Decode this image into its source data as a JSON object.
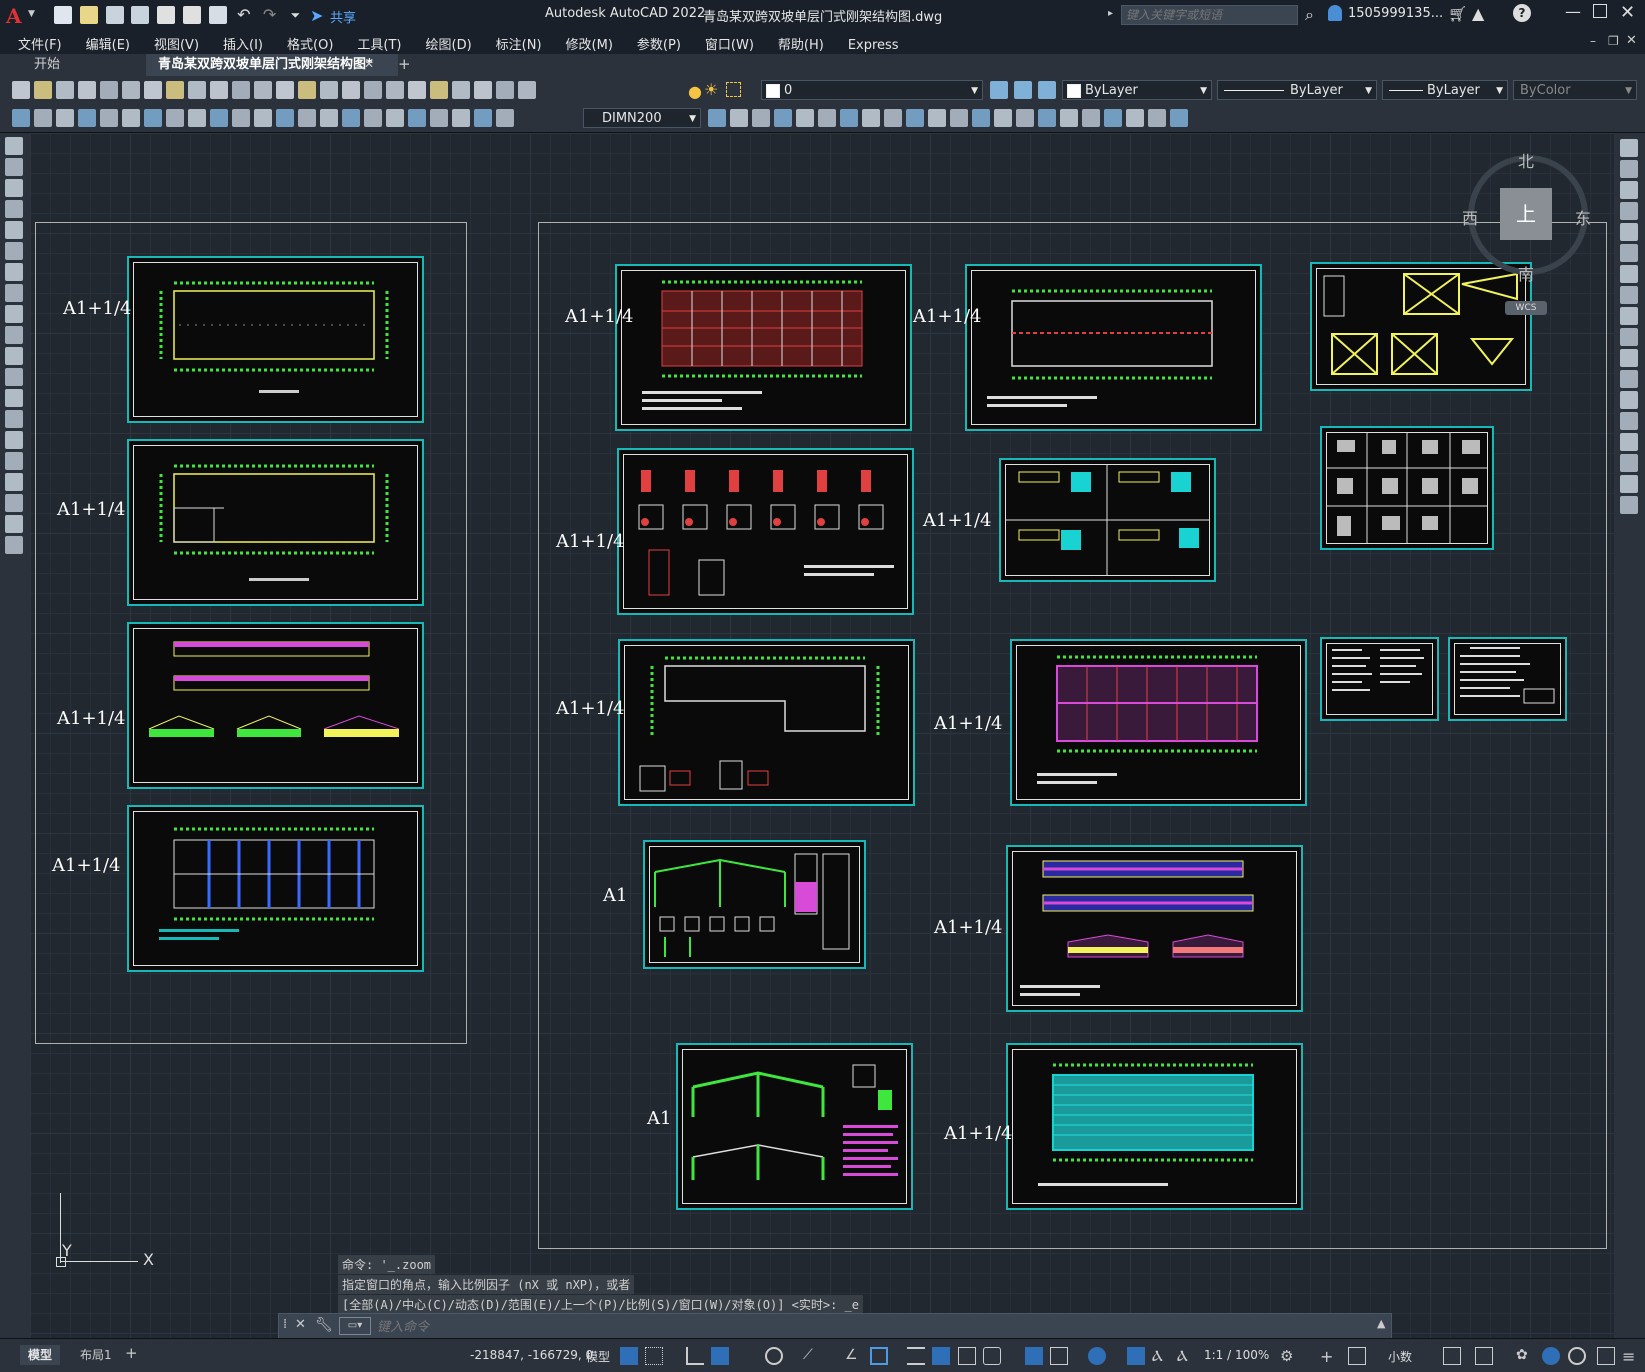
{
  "app": {
    "title": "Autodesk AutoCAD 2022",
    "filename": "青岛某双跨双坡单层门式刚架结构图.dwg",
    "share_label": "共享",
    "search_placeholder": "键入关键字或短语",
    "user": "1505999135...",
    "brand_color": "#c62b2b"
  },
  "menu": [
    "文件(F)",
    "编辑(E)",
    "视图(V)",
    "插入(I)",
    "格式(O)",
    "工具(T)",
    "绘图(D)",
    "标注(N)",
    "修改(M)",
    "参数(P)",
    "窗口(W)",
    "帮助(H)",
    "Express"
  ],
  "tabs": [
    {
      "label": "开始"
    },
    {
      "label": "青岛某双跨双坡单层门式刚架结构图*"
    }
  ],
  "toolbar": {
    "layer_value": "0",
    "color_value": "ByLayer",
    "linetype_value": "ByLayer",
    "lineweight_value": "ByLayer",
    "plotstyle_value": "ByColor",
    "dimstyle_value": "DIMN200"
  },
  "viewcube": {
    "north": "北",
    "south": "南",
    "east": "东",
    "west": "西",
    "top": "上",
    "wcs": "WCS"
  },
  "ucs": {
    "y": "Y",
    "x": "X"
  },
  "sheet_labels": {
    "left": [
      "A1+1/4",
      "A1+1/4",
      "A1+1/4",
      "A1+1/4"
    ],
    "right": [
      "A1+1/4",
      "A1+1/4",
      "A1+1/4",
      "A1+1/4",
      "A1+1/4",
      "A1+1/4",
      "A1",
      "A1+1/4",
      "A1",
      "A1+1/4"
    ]
  },
  "command_history": [
    "命令: '_.zoom",
    "指定窗口的角点，输入比例因子 (nX 或 nXP)，或者",
    "[全部(A)/中心(C)/动态(D)/范围(E)/上一个(P)/比例(S)/窗口(W)/对象(O)] <实时>: _e"
  ],
  "command_placeholder": "键入命令",
  "status": {
    "model_tab": "模型",
    "layout_tab": "布局1",
    "coords": "-218847, -166729, 0",
    "model_label": "模型",
    "scale": "1:1 / 100%",
    "units": "小数"
  }
}
